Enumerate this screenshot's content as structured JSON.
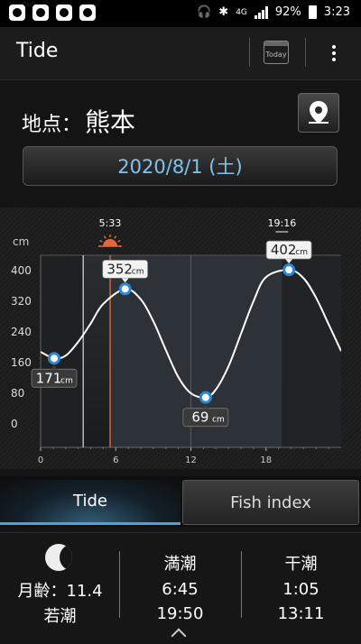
{
  "status_bar": {
    "battery": "92%",
    "time": "3:23",
    "network": "4G"
  },
  "app": {
    "title": "Tide",
    "today_label": "Today"
  },
  "location": {
    "label": "地点：",
    "value": "熊本"
  },
  "date": "2020/8/1 (土)",
  "chart_data": {
    "type": "line",
    "ylabel": "cm",
    "ylim": [
      0,
      480
    ],
    "yticks": [
      0,
      80,
      160,
      240,
      320,
      400
    ],
    "xlim": [
      0,
      24
    ],
    "xticks": [
      0,
      6,
      12,
      18
    ],
    "x": [
      0,
      1.08,
      2,
      3,
      4,
      5,
      6.75,
      8,
      9,
      10,
      11,
      12,
      13.18,
      14,
      15,
      16,
      17,
      18,
      19.83,
      21,
      22,
      23,
      24
    ],
    "y": [
      188,
      171,
      178,
      214,
      262,
      313,
      352,
      325,
      268,
      193,
      122,
      80,
      69,
      90,
      150,
      235,
      320,
      383,
      402,
      380,
      329,
      260,
      190
    ],
    "sunrise": "5:33",
    "sunset": "19:16",
    "sunrise_hour": 5.55,
    "sunset_hour": 19.27,
    "night_before": 3.4,
    "extremes": [
      {
        "hour": 1.08,
        "value": 171,
        "label": "171",
        "unit": "cm",
        "kind": "low"
      },
      {
        "hour": 6.75,
        "value": 352,
        "label": "352",
        "unit": "cm",
        "kind": "high"
      },
      {
        "hour": 13.18,
        "value": 69,
        "label": "69",
        "unit": "cm",
        "kind": "low"
      },
      {
        "hour": 19.83,
        "value": 402,
        "label": "402",
        "unit": "cm",
        "kind": "high"
      }
    ]
  },
  "tabs": [
    {
      "label": "Tide",
      "active": true
    },
    {
      "label": "Fish index",
      "active": false
    }
  ],
  "moon": {
    "age_label": "月齢：11.4",
    "phase_name": "若潮"
  },
  "high_tide": {
    "title": "満潮",
    "times": [
      "6:45",
      "19:50"
    ]
  },
  "low_tide": {
    "title": "干潮",
    "times": [
      "1:05",
      "13:11"
    ]
  },
  "colors": {
    "accent": "#4aa3dc",
    "date_text": "#7fc4f0",
    "sunrise": "#e8643c",
    "point": "#2b87d8"
  }
}
